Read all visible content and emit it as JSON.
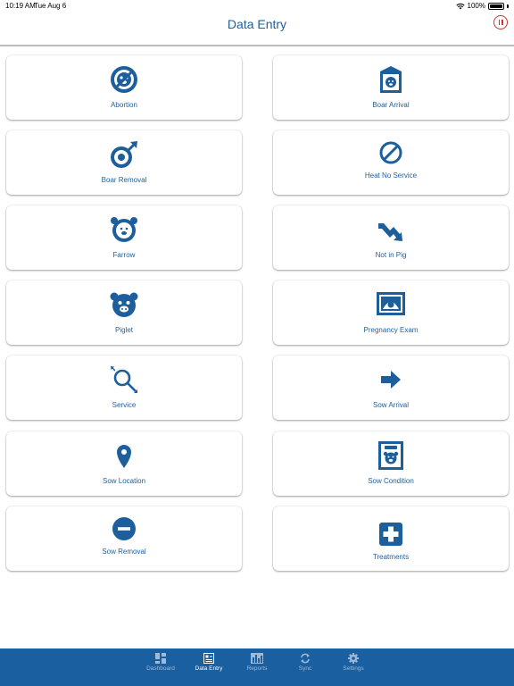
{
  "status_bar": {
    "time": "10:19 AM",
    "date": "Tue Aug 6",
    "battery": "100%"
  },
  "header": {
    "title": "Data Entry"
  },
  "colors": {
    "accent": "#1d5f9c",
    "tab_bar": "#1a5f9f",
    "pause": "#d0322d"
  },
  "tiles": [
    {
      "label": "Abortion",
      "icon": "abortion-icon"
    },
    {
      "label": "Boar Arrival",
      "icon": "boar-arrival-icon"
    },
    {
      "label": "Boar Removal",
      "icon": "boar-removal-icon"
    },
    {
      "label": "Heat No Service",
      "icon": "heat-no-service-icon"
    },
    {
      "label": "Farrow",
      "icon": "farrow-icon"
    },
    {
      "label": "Not in Pig",
      "icon": "not-in-pig-icon"
    },
    {
      "label": "Piglet",
      "icon": "piglet-icon"
    },
    {
      "label": "Pregnancy Exam",
      "icon": "pregnancy-exam-icon"
    },
    {
      "label": "Service",
      "icon": "service-icon"
    },
    {
      "label": "Sow Arrival",
      "icon": "sow-arrival-icon"
    },
    {
      "label": "Sow Location",
      "icon": "location-pin-icon"
    },
    {
      "label": "Sow Condition",
      "icon": "sow-condition-icon"
    },
    {
      "label": "Sow Removal",
      "icon": "sow-removal-icon"
    },
    {
      "label": "Treatments",
      "icon": "treatments-icon"
    }
  ],
  "tab_bar": {
    "items": [
      {
        "label": "Dashboard",
        "icon": "dashboard-icon"
      },
      {
        "label": "Data Entry",
        "icon": "data-entry-icon",
        "active": true
      },
      {
        "label": "Reports",
        "icon": "reports-icon"
      },
      {
        "label": "Sync",
        "icon": "sync-icon"
      },
      {
        "label": "Settings",
        "icon": "settings-icon"
      }
    ]
  }
}
